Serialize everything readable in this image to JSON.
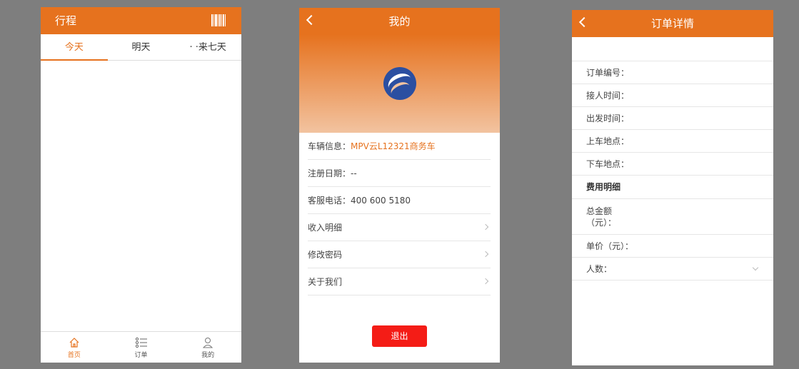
{
  "screen_trips": {
    "title": "行程",
    "barcode_icon": "barcode-icon",
    "tabs": [
      {
        "label": "今天",
        "active": true
      },
      {
        "label": "明天",
        "active": false
      },
      {
        "label": "· ·来七天",
        "active": false
      }
    ],
    "tabbar": [
      {
        "label": "首页",
        "icon": "home-icon",
        "active": true
      },
      {
        "label": "订单",
        "icon": "list-icon",
        "active": false
      },
      {
        "label": "我的",
        "icon": "user-icon",
        "active": false
      }
    ]
  },
  "screen_mine": {
    "title": "我的",
    "back_icon": "chevron-left-icon",
    "logo_icon": "company-logo-icon",
    "vehicle_label": "车辆信息：",
    "vehicle_value": "MPV云L12321商务车",
    "reg_label": "注册日期：",
    "reg_value": "--",
    "phone_label": "客服电话：",
    "phone_value": "400 600 5180",
    "menu": [
      {
        "label": "收入明细"
      },
      {
        "label": "修改密码"
      },
      {
        "label": "关于我们"
      }
    ],
    "logout_label": "退出"
  },
  "screen_detail": {
    "title": "订单详情",
    "back_icon": "chevron-left-icon",
    "fields": [
      "订单编号：",
      "接人时间：",
      "出发时间：",
      "上车地点：",
      "下车地点："
    ],
    "section_header": "费用明细",
    "total_line1": "总金额",
    "total_line2": "（元）：",
    "unit_price": "单价（元）：",
    "people": "人数："
  },
  "colors": {
    "accent": "#e6721e",
    "logout": "#f41c16",
    "background": "#7e7e7e"
  }
}
